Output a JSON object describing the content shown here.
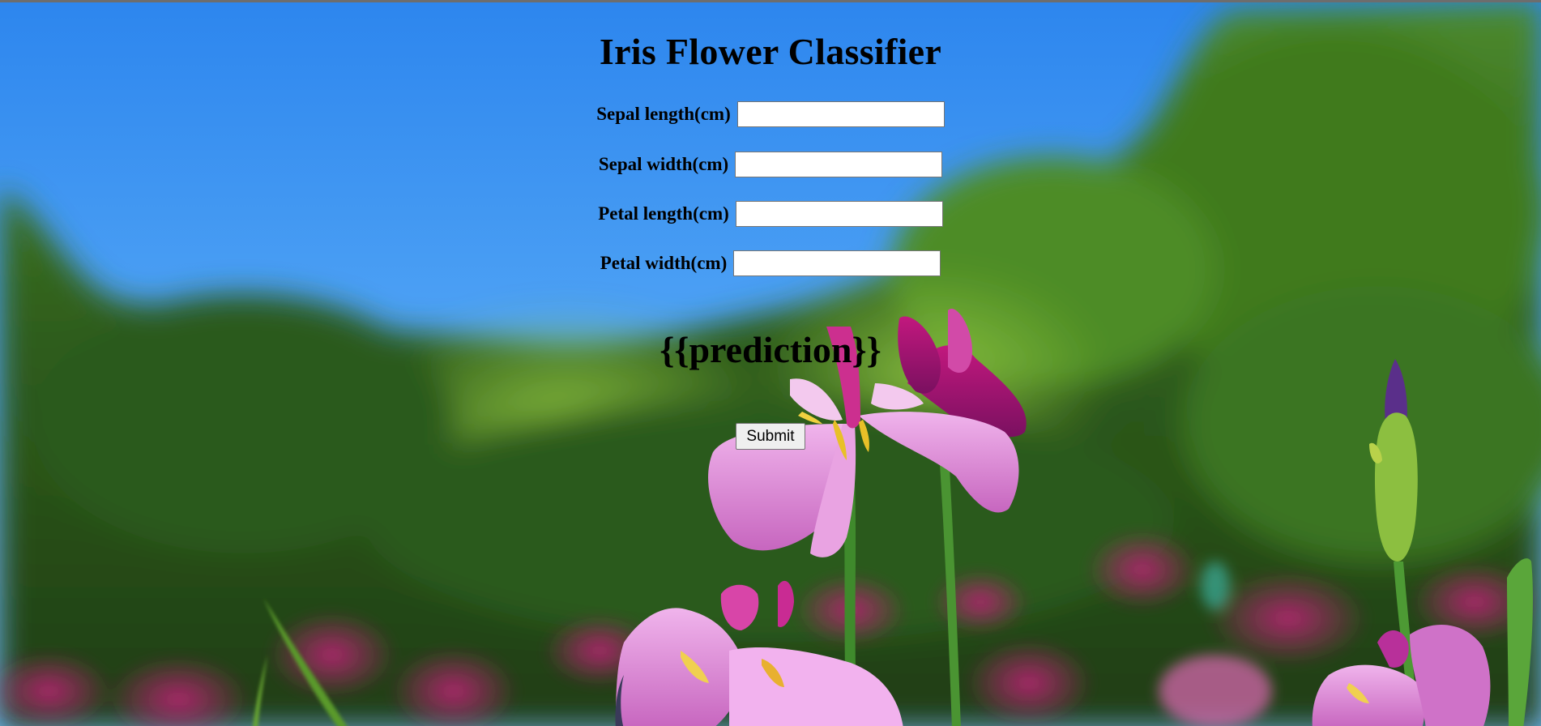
{
  "page": {
    "title": "Iris Flower Classifier"
  },
  "form": {
    "fields": [
      {
        "label": "Sepal length(cm)",
        "value": "",
        "placeholder": ""
      },
      {
        "label": "Sepal width(cm)",
        "value": "",
        "placeholder": ""
      },
      {
        "label": "Petal length(cm)",
        "value": "",
        "placeholder": ""
      },
      {
        "label": "Petal width(cm)",
        "value": "",
        "placeholder": ""
      }
    ],
    "prediction_text": "{{prediction}}",
    "submit_label": "Submit"
  },
  "colors": {
    "sky": "#4a9ff0",
    "foliage": "#3f7a2a",
    "flower": "#d673c8",
    "text": "#000000"
  }
}
